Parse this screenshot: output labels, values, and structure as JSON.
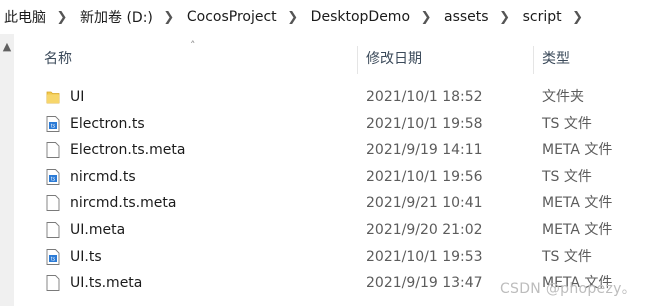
{
  "breadcrumb": {
    "items": [
      "此电脑",
      "新加卷 (D:)",
      "CocosProject",
      "DesktopDemo",
      "assets",
      "script"
    ]
  },
  "columns": {
    "name": "名称",
    "date": "修改日期",
    "type": "类型"
  },
  "files": [
    {
      "name": "UI",
      "date": "2021/10/1 18:52",
      "type": "文件夹",
      "icon": "folder-icon"
    },
    {
      "name": "Electron.ts",
      "date": "2021/10/1 19:58",
      "type": "TS 文件",
      "icon": "ts-file-icon"
    },
    {
      "name": "Electron.ts.meta",
      "date": "2021/9/19 14:11",
      "type": "META 文件",
      "icon": "file-icon"
    },
    {
      "name": "nircmd.ts",
      "date": "2021/10/1 19:56",
      "type": "TS 文件",
      "icon": "ts-file-icon"
    },
    {
      "name": "nircmd.ts.meta",
      "date": "2021/9/21 10:41",
      "type": "META 文件",
      "icon": "file-icon"
    },
    {
      "name": "UI.meta",
      "date": "2021/9/20 21:02",
      "type": "META 文件",
      "icon": "file-icon"
    },
    {
      "name": "UI.ts",
      "date": "2021/10/1 19:53",
      "type": "TS 文件",
      "icon": "ts-file-icon"
    },
    {
      "name": "UI.ts.meta",
      "date": "2021/9/19 13:47",
      "type": "META 文件",
      "icon": "file-icon"
    }
  ],
  "watermark": "CSDN @phopezy。",
  "colors": {
    "folder": "#f2c94c",
    "ts_icon": "#2b7bd6",
    "header_text": "#3b4a5a",
    "date_text": "#5c5c5c"
  }
}
